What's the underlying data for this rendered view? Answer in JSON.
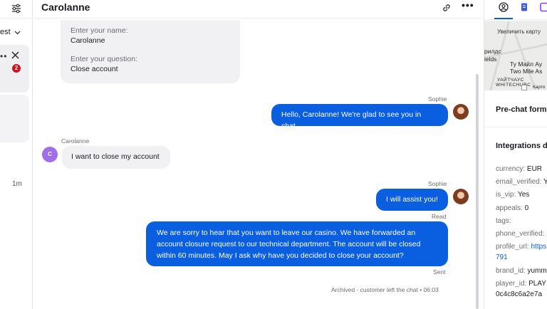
{
  "left": {
    "sort_label": "est",
    "dots": "••",
    "badge_count": "2",
    "time": "1m"
  },
  "header": {
    "title": "Carolanne",
    "more": "•••"
  },
  "prechat": {
    "q1": "Enter your name:",
    "a1": "Carolanne",
    "q2": "Enter your question:",
    "a2": "Close account"
  },
  "messages": [
    {
      "sender": "Sophie",
      "text": "Hello, Carolanne! We're glad to see you in chat."
    },
    {
      "sender": "Carolanne",
      "avatar": "C",
      "text": "I want to close my account"
    },
    {
      "sender": "Sophie",
      "text": "I will assist you!",
      "status": "Read"
    },
    {
      "text_lines": [
        "We are sorry to hear that you want to leave our casino. We have forwarded an",
        "account closure request to our technical department. The account will be closed",
        "within 60 minutes. May I ask why have you decided to close your account?"
      ],
      "status": "Sent"
    }
  ],
  "archived": "Archived - customer left the chat • 06:03",
  "right": {
    "map": {
      "enlarge": "Увеличить карту",
      "label_a1": "рилдс",
      "label_a2": "ields",
      "label_b1": "Ту Майл Ау",
      "label_b2": "Two Mile As",
      "label_c1": "УАЙТЧАУС",
      "label_c2": "WHITECHURC",
      "label_d": "Карто"
    },
    "prechat_title": "Pre-chat form",
    "integrations_title": "Integrations d",
    "fields": [
      {
        "k": "currency:",
        "v": "EUR"
      },
      {
        "k": "email_verified:",
        "v": "Y"
      },
      {
        "k": "is_vip:",
        "v": "Yes"
      },
      {
        "k": "appeals:",
        "v": "0"
      },
      {
        "k": "tags:",
        "v": ""
      },
      {
        "k": "phone_verified:",
        "v": ""
      },
      {
        "k": "profile_url:",
        "v": "https"
      },
      {
        "k": "",
        "v": "791"
      },
      {
        "k": "brand_id:",
        "v": "yumm"
      },
      {
        "k": "player_id:",
        "v": "PLAY"
      },
      {
        "k": "",
        "v": "0c4c8c6a2e7a"
      }
    ]
  },
  "colors": {
    "accent": "#0a5fe0",
    "badge": "#d0121f",
    "customer_avatar": "#a06ee8"
  }
}
